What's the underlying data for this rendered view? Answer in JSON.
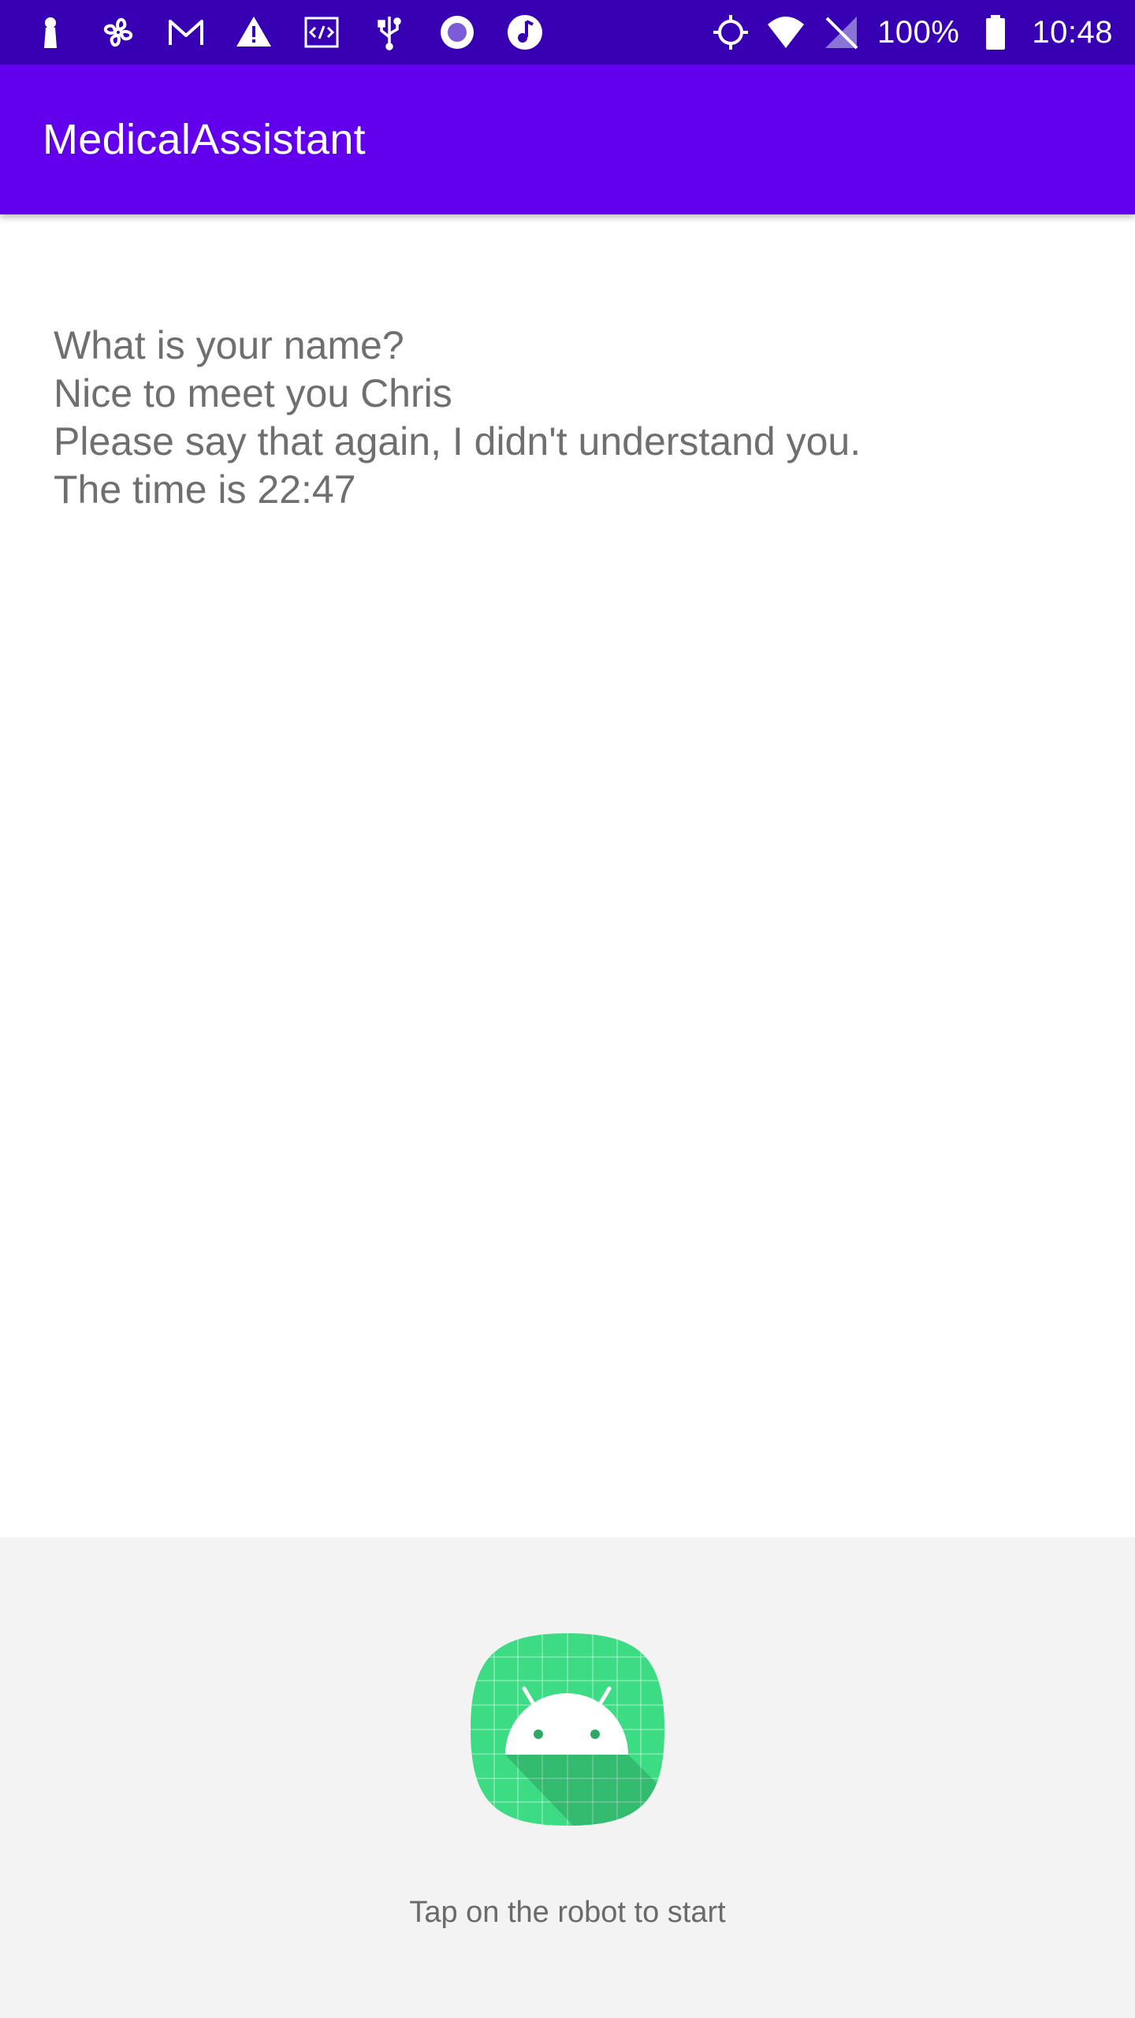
{
  "status_bar": {
    "left_icons": [
      "keyhole-icon",
      "fan-icon",
      "gmail-icon",
      "warning-icon",
      "code-icon",
      "usb-icon",
      "record-icon",
      "music-icon"
    ],
    "right_icons": [
      "location-icon",
      "wifi-icon",
      "no-signal-icon",
      "battery-icon"
    ],
    "battery": "100%",
    "time": "10:48"
  },
  "app_bar": {
    "title": "MedicalAssistant"
  },
  "conversation": {
    "lines": [
      "What is your name?",
      "Nice to meet you Chris",
      "Please say that again, I didn't understand you.",
      "The time is 22:47"
    ]
  },
  "bottom_panel": {
    "robot_icon": "android-robot-icon",
    "hint": "Tap on the robot to start"
  },
  "colors": {
    "status_bar": "#3700b3",
    "app_bar": "#6200ee",
    "robot_green": "#3ddc84",
    "bottom_panel": "#f3f3f3"
  }
}
